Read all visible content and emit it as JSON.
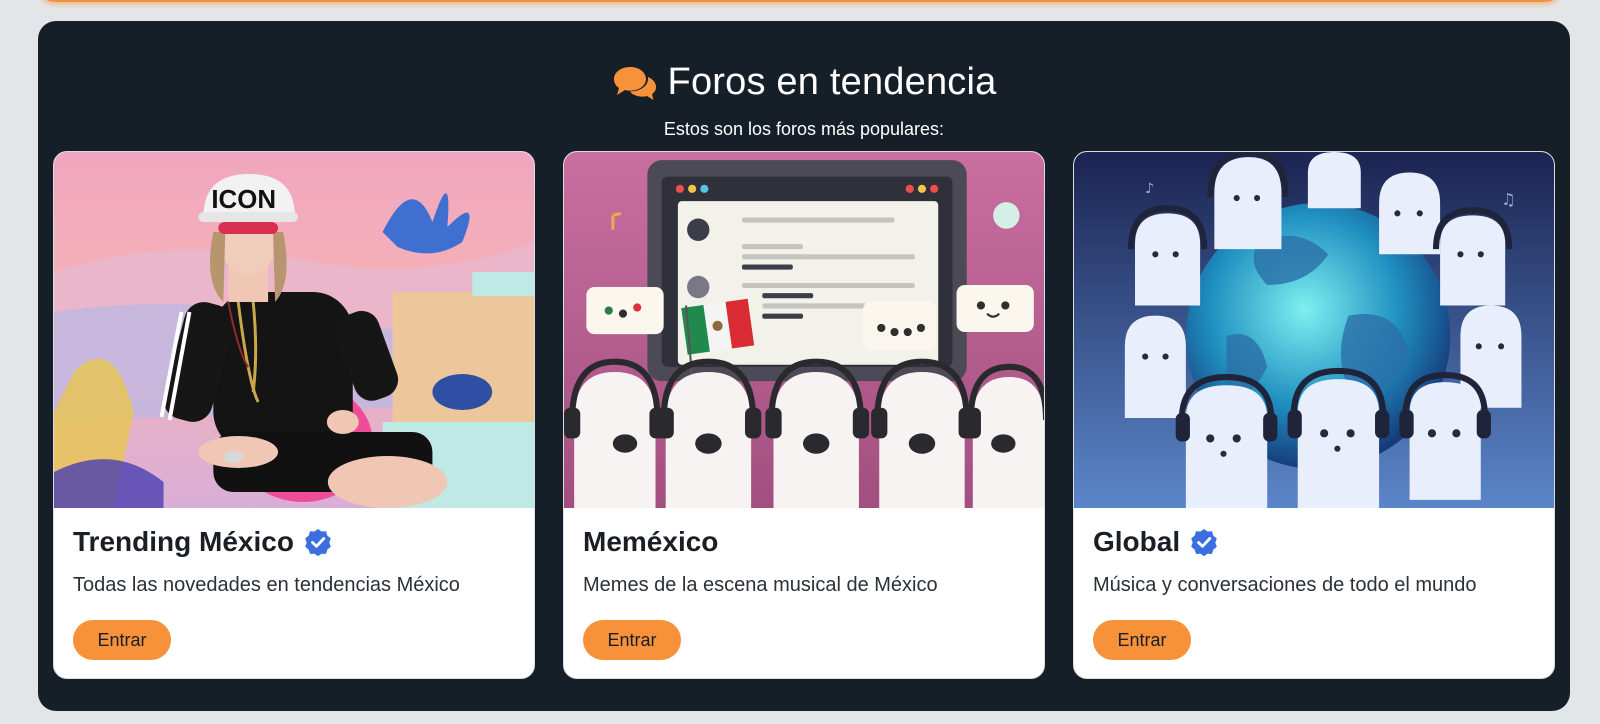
{
  "section": {
    "title": "Foros en tendencia",
    "subtitle": "Estos son los foros más populares:",
    "icon": "chat-bubbles-icon"
  },
  "colors": {
    "accent": "#f7923a",
    "panel_bg": "#161f28",
    "verified": "#3b6fe0"
  },
  "forums": [
    {
      "title": "Trending México",
      "verified": true,
      "description": "Todas las novedades en tendencias México",
      "button_label": "Entrar",
      "image": "artist-in-black-outfit-with-icon-cap"
    },
    {
      "title": "Meméxico",
      "verified": false,
      "description": "Memes de la escena musical de México",
      "button_label": "Entrar",
      "image": "laughing-ghosts-with-headphones-and-mexico-flag"
    },
    {
      "title": "Global",
      "verified": true,
      "description": "Música y conversaciones de todo el mundo",
      "button_label": "Entrar",
      "image": "ghosts-with-headphones-around-globe"
    }
  ],
  "image_text": {
    "cap_text": "ICON"
  }
}
